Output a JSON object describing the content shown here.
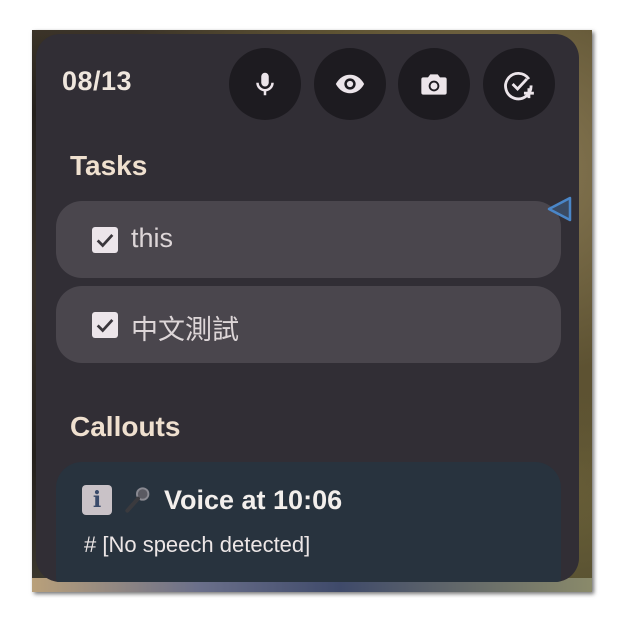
{
  "header": {
    "counter": "08/13",
    "buttons": [
      {
        "icon": "microphone-icon"
      },
      {
        "icon": "eye-icon"
      },
      {
        "icon": "camera-icon"
      },
      {
        "icon": "add-task-icon"
      }
    ]
  },
  "tasks": {
    "title": "Tasks",
    "items": [
      {
        "label": "this",
        "checked": true
      },
      {
        "label": "中文測試",
        "checked": true
      }
    ]
  },
  "callouts": {
    "title": "Callouts",
    "items": [
      {
        "emoji_info": "ℹ️",
        "emoji_mic": "🎤",
        "title": "Voice at 10:06",
        "body": "# [No speech detected]"
      }
    ]
  },
  "colors": {
    "panel_bg": "#312e35",
    "button_bg": "#1d1b20",
    "task_bg": "#4a464d",
    "callout_bg": "#28333e",
    "title_text": "#efe0cf",
    "side_tab_accent": "#4a86c8"
  }
}
